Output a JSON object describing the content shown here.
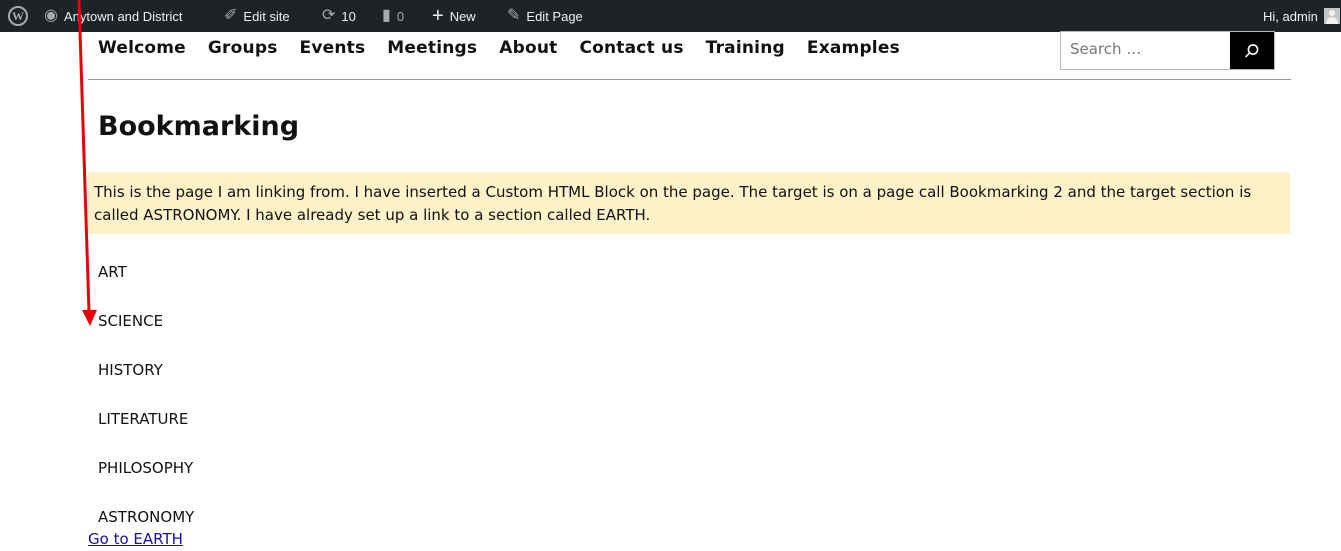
{
  "admin_bar": {
    "site_name": "Anytown and District",
    "edit_site": "Edit site",
    "updates_count": "10",
    "comments_count": "0",
    "new_label": "New",
    "edit_page": "Edit Page",
    "greeting": "Hi, admin"
  },
  "nav": {
    "items": [
      "Welcome",
      "Groups",
      "Events",
      "Meetings",
      "About",
      "Contact us",
      "Training",
      "Examples"
    ]
  },
  "search": {
    "placeholder": "Search …"
  },
  "page": {
    "title": "Bookmarking",
    "notice": "This is the page I am linking from. I have inserted a Custom HTML Block on the page. The target is on a page call Bookmarking 2 and the target section is called ASTRONOMY. I have already set up a link to a section called EARTH.",
    "sections": [
      "ART",
      "SCIENCE",
      "HISTORY",
      "LITERATURE",
      "PHILOSOPHY",
      "ASTRONOMY"
    ],
    "link_text": "Go to EARTH"
  },
  "colors": {
    "admin_bar_bg": "#1d2327",
    "notice_bg": "#fff2c9",
    "link": "#1a0dab",
    "annotation_arrow": "#e8000b"
  }
}
